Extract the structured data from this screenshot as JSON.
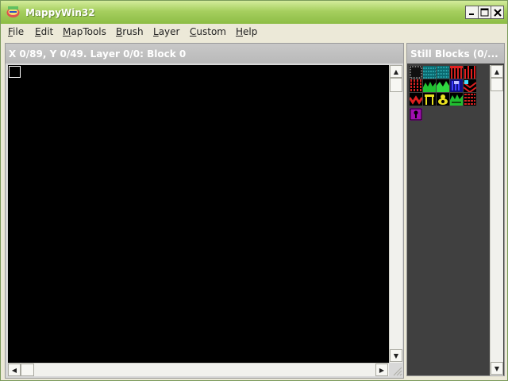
{
  "window": {
    "title": "MappyWin32",
    "minimize_label": "_",
    "maximize_label": "□",
    "close_label": "✕"
  },
  "menu": [
    {
      "accel": "F",
      "rest": "ile"
    },
    {
      "accel": "E",
      "rest": "dit"
    },
    {
      "accel": "M",
      "rest": "apTools"
    },
    {
      "accel": "B",
      "rest": "rush"
    },
    {
      "accel": "L",
      "rest": "ayer"
    },
    {
      "accel": "C",
      "rest": "ustom"
    },
    {
      "accel": "H",
      "rest": "elp"
    }
  ],
  "map_panel": {
    "status": "X 0/89, Y 0/49. Layer 0/0: Block 0"
  },
  "tiles_panel": {
    "title": "Still Blocks (0/...",
    "tile_count": 16
  },
  "icons": {
    "scroll_up": "▲",
    "scroll_down": "▼",
    "scroll_left": "◀",
    "scroll_right": "▶"
  },
  "colors": {
    "titlebar_top": "#d4ec9c",
    "titlebar_bottom": "#8dbd45",
    "map_background": "#000000",
    "tiles_background": "#404040"
  }
}
